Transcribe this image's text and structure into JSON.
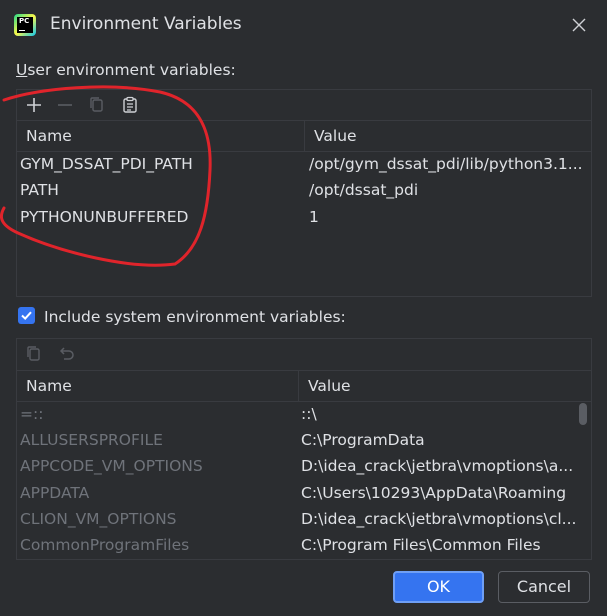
{
  "window": {
    "title": "Environment Variables",
    "app_icon_text": "PC"
  },
  "user_section": {
    "label_underlined": "U",
    "label_rest": "ser environment variables:",
    "columns": {
      "name": "Name",
      "value": "Value"
    },
    "rows": [
      {
        "name": "GYM_DSSAT_PDI_PATH",
        "value": "/opt/gym_dssat_pdi/lib/python3.1..."
      },
      {
        "name": "PATH",
        "value": "/opt/dssat_pdi"
      },
      {
        "name": "PYTHONUNBUFFERED",
        "value": "1"
      }
    ]
  },
  "system_section": {
    "checkbox_label": "Include system environment variables:",
    "checked": true,
    "columns": {
      "name": "Name",
      "value": "Value"
    },
    "rows": [
      {
        "name": "=::",
        "value": "::\\"
      },
      {
        "name": "ALLUSERSPROFILE",
        "value": "C:\\ProgramData"
      },
      {
        "name": "APPCODE_VM_OPTIONS",
        "value": "D:\\idea_crack\\jetbra\\vmoptions\\a..."
      },
      {
        "name": "APPDATA",
        "value": "C:\\Users\\10293\\AppData\\Roaming"
      },
      {
        "name": "CLION_VM_OPTIONS",
        "value": "D:\\idea_crack\\jetbra\\vmoptions\\cl..."
      },
      {
        "name": "CommonProgramFiles",
        "value": "C:\\Program Files\\Common Files"
      }
    ]
  },
  "buttons": {
    "ok": "OK",
    "cancel": "Cancel"
  },
  "colors": {
    "accent": "#3574f0",
    "annotation": "#e0242b",
    "background": "#2b2d30"
  }
}
